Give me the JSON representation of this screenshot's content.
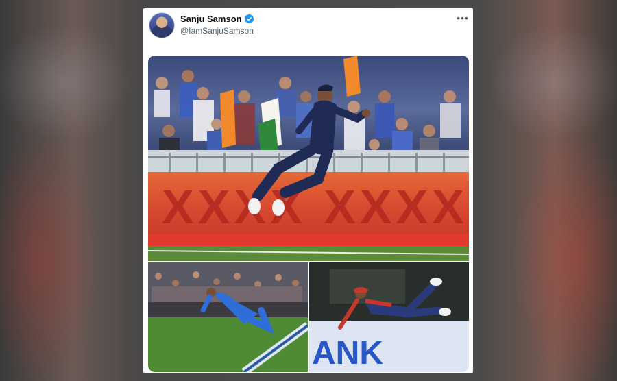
{
  "tweet": {
    "display_name": "Sanju Samson",
    "handle": "@IamSanjuSamson",
    "verified": true,
    "more_icon": "more-horizontal-icon"
  },
  "media": {
    "main_photo": {
      "boundary_text": "XXXX XXXX"
    },
    "bottom_left_photo": {},
    "bottom_right_photo": {
      "board_text": "ANK"
    }
  },
  "colors": {
    "verified_blue": "#1d9bf0",
    "name_text": "#0f1419",
    "handle_text": "#536471",
    "jersey_navy": "#1f2a55",
    "boundary_red": "#d7402f"
  }
}
